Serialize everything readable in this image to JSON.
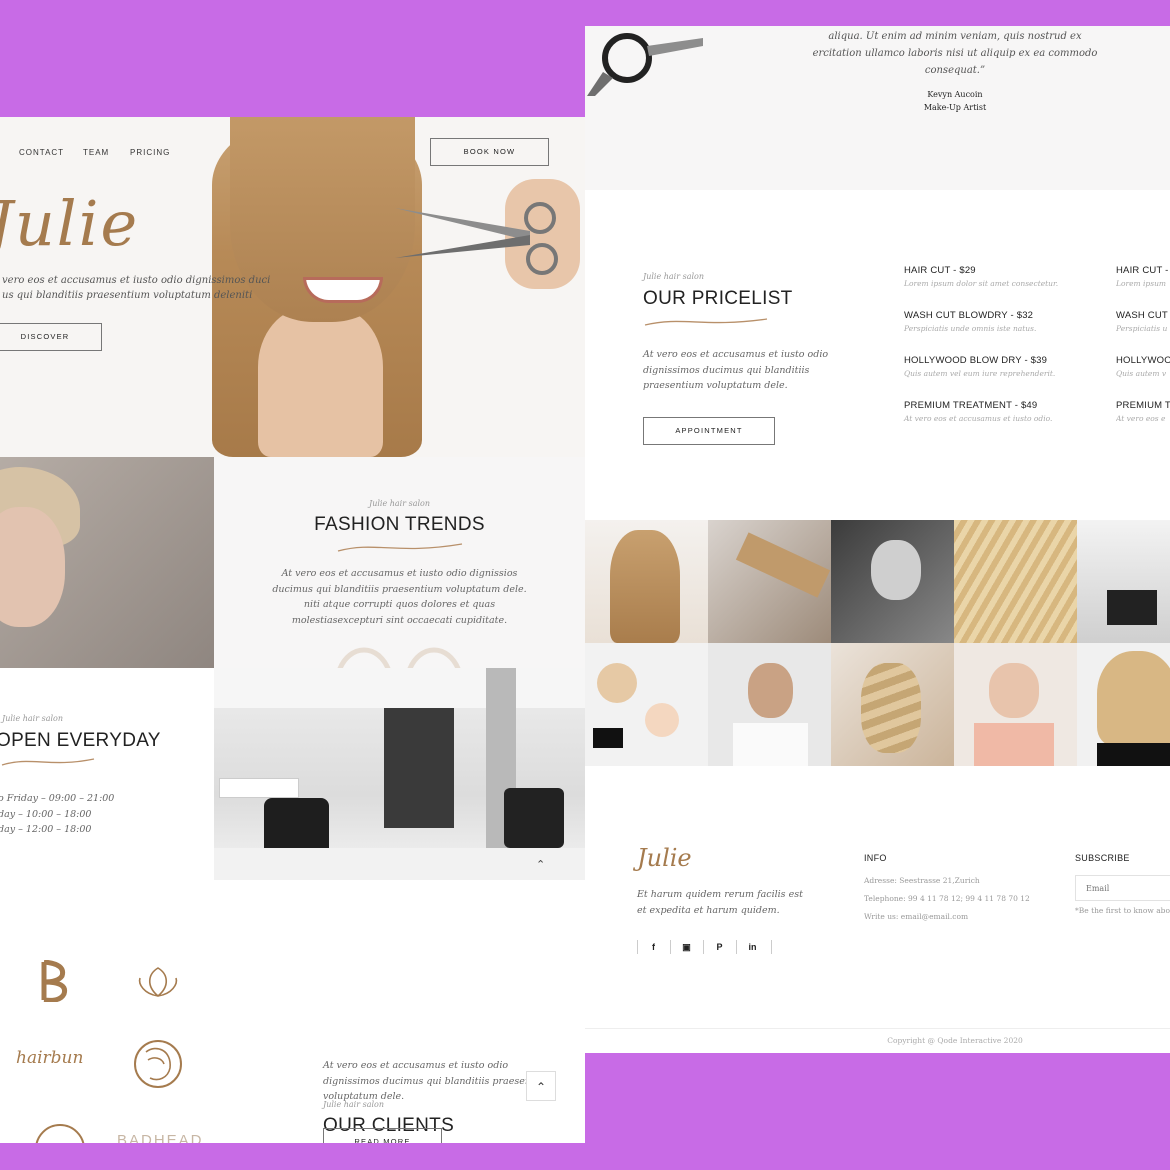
{
  "nav": {
    "contact": "CONTACT",
    "team": "TEAM",
    "pricing": "PRICING",
    "book_now": "BOOK NOW"
  },
  "hero": {
    "logo": "Julie",
    "text_line1": "vero eos et accusamus et iusto odio dignissimos duci",
    "text_line2": "us qui blanditiis praesentium voluptatum deleniti",
    "discover": "DISCOVER"
  },
  "fashion": {
    "eyebrow": "Julie hair salon",
    "title": "FASHION TRENDS",
    "lines": [
      "At vero eos et accusamus et iusto odio dignissios",
      "ducimus qui blanditiis praesentium voluptatum dele.",
      "niti atque corrupti quos dolores et quas",
      "molestiasexcepturi sint occaecati cupiditate."
    ]
  },
  "open": {
    "eyebrow": "Julie hair salon",
    "title": "OPEN EVERYDAY",
    "hours": [
      "o Friday – 09:00 – 21:00",
      "day – 10:00 – 18:00",
      "day – 12:00 – 18:00"
    ]
  },
  "clients": {
    "eyebrow": "Julie hair salon",
    "title": "OUR CLIENTS",
    "lines": [
      "At vero eos et accusamus et iusto odio",
      "dignissimos ducimus qui blanditiis praesentium",
      "voluptatum dele."
    ],
    "read_more": "READ MORE",
    "logo_hairbun": "hairbun",
    "logo_badhead": "BADHEAD"
  },
  "testimonial": {
    "lines": [
      "aliqua. Ut enim ad minim veniam, quis nostrud ex",
      "ercitation ullamco laboris nisi ut aliquip ex ea commodo",
      "consequat.”"
    ],
    "author": "Kevyn Aucoin",
    "role": "Make-Up Artist"
  },
  "pricelist": {
    "eyebrow": "Julie hair salon",
    "title": "OUR PRICELIST",
    "lines": [
      "At vero eos et accusamus et iusto odio",
      "dignissimos ducimus qui blanditiis",
      "praesentium voluptatum dele."
    ],
    "appointment": "APPOINTMENT",
    "col1": [
      {
        "name": "HAIR CUT - $29",
        "desc": "Lorem ipsum dolor sit amet consectetur."
      },
      {
        "name": "WASH CUT BLOWDRY - $32",
        "desc": "Perspiciatis unde omnis iste natus."
      },
      {
        "name": "HOLLYWOOD BLOW DRY - $39",
        "desc": "Quis autem vel eum iure reprehenderit."
      },
      {
        "name": "PREMIUM TREATMENT - $49",
        "desc": "At vero eos et accusamus et iusto odio."
      }
    ],
    "col2": [
      {
        "name": "HAIR CUT -",
        "desc": "Lorem ipsum"
      },
      {
        "name": "WASH CUT",
        "desc": "Perspiciatis u"
      },
      {
        "name": "HOLLYWOO",
        "desc": "Quis autem v"
      },
      {
        "name": "PREMIUM T",
        "desc": "At vero eos e"
      }
    ]
  },
  "footer": {
    "logo": "Julie",
    "tagline_1": "Et harum quidem rerum facilis est",
    "tagline_2": "et expedita et harum quidem.",
    "social": [
      "f",
      "▣",
      "P",
      "in"
    ],
    "info_title": "INFO",
    "address": "Adresse: Seestrasse 21,Zurich",
    "telephone": "Telephone: 99 4 11 78 12; 99 4 11 78 70 12",
    "email": "Write us: email@email.com",
    "subscribe_title": "SUBSCRIBE",
    "email_placeholder": "Email",
    "subscribe_note": "*Be the first to know abo",
    "copyright": "Copyright @ Qode Interactive 2020"
  },
  "colors": {
    "accent": "#a57b4e",
    "background": "#c86be6"
  }
}
